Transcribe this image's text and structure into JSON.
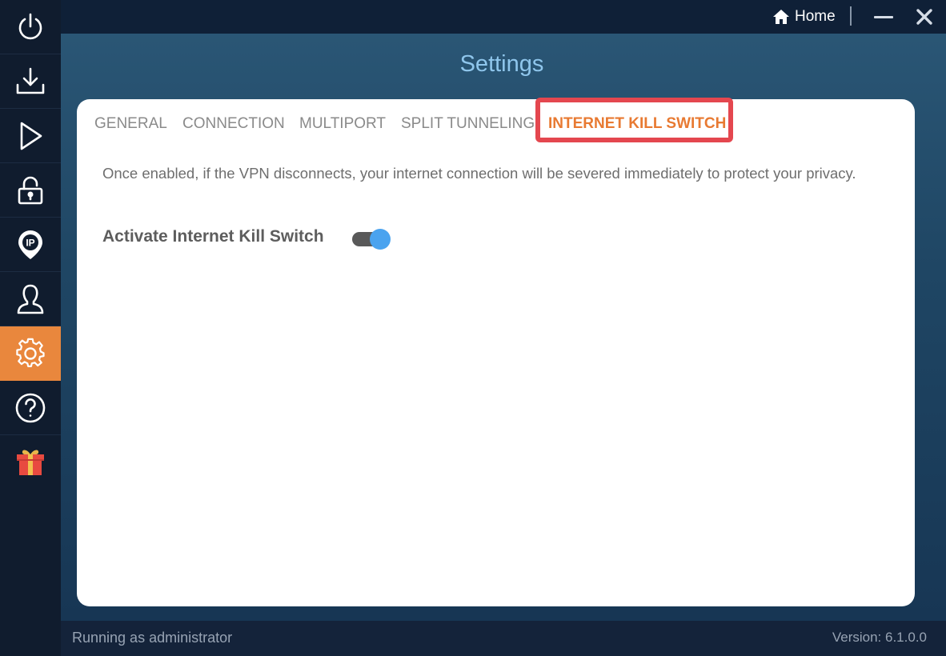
{
  "window": {
    "home_label": "Home",
    "title": "Settings"
  },
  "sidebar": {
    "items": [
      {
        "icon": "power-icon",
        "active": false
      },
      {
        "icon": "download-icon",
        "active": false
      },
      {
        "icon": "play-icon",
        "active": false
      },
      {
        "icon": "lock-icon",
        "active": false
      },
      {
        "icon": "ip-location-icon",
        "active": false
      },
      {
        "icon": "account-icon",
        "active": false
      },
      {
        "icon": "gear-icon",
        "active": true
      },
      {
        "icon": "help-icon",
        "active": false
      },
      {
        "icon": "gift-icon",
        "active": false
      }
    ]
  },
  "settings": {
    "tabs": [
      {
        "label": "GENERAL",
        "active": false
      },
      {
        "label": "CONNECTION",
        "active": false
      },
      {
        "label": "MULTIPORT",
        "active": false
      },
      {
        "label": "SPLIT TUNNELING",
        "active": false
      },
      {
        "label": "INTERNET KILL SWITCH",
        "active": true
      }
    ],
    "description": "Once enabled, if the VPN disconnects, your internet connection will be severed immediately to protect your privacy.",
    "kill_switch": {
      "label": "Activate Internet Kill Switch",
      "enabled": true
    }
  },
  "status": {
    "left": "Running as administrator",
    "version": "Version:  6.1.0.0"
  },
  "colors": {
    "accent": "#e9873d",
    "highlight_border": "#e4474f",
    "toggle_on": "#4aa3ef",
    "title": "#8fc6ec"
  }
}
